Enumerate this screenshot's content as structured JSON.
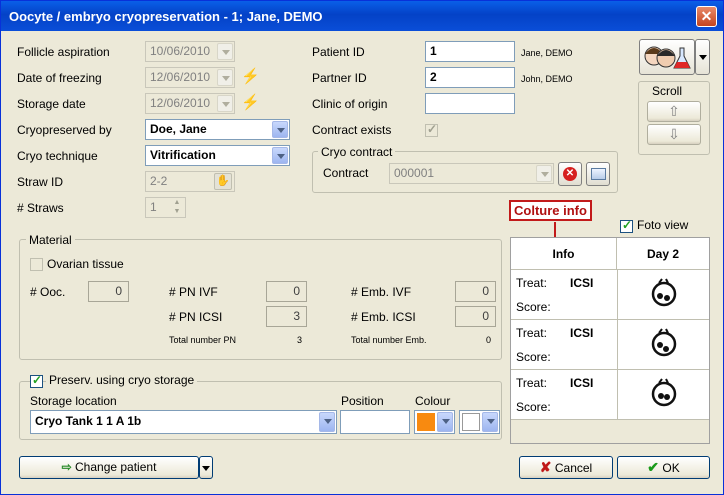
{
  "window": {
    "title": "Oocyte / embryo cryopreservation - 1; Jane, DEMO",
    "close_glyph": "✕"
  },
  "left": {
    "follicle_aspiration": {
      "label": "Follicle aspiration",
      "value": "10/06/2010"
    },
    "date_of_freezing": {
      "label": "Date of freezing",
      "value": "12/06/2010"
    },
    "storage_date": {
      "label": "Storage date",
      "value": "12/06/2010"
    },
    "cryopreserved_by": {
      "label": "Cryopreserved by",
      "value": "Doe, Jane"
    },
    "cryo_technique": {
      "label": "Cryo technique",
      "value": "Vitrification"
    },
    "straw_id": {
      "label": "Straw ID",
      "value": "2-2"
    },
    "straws": {
      "label": "# Straws",
      "value": "1"
    }
  },
  "middle": {
    "patient_id": {
      "label": "Patient ID",
      "value": "1",
      "name": "Jane, DEMO"
    },
    "partner_id": {
      "label": "Partner ID",
      "value": "2",
      "name": "John, DEMO"
    },
    "clinic_of_origin": {
      "label": "Clinic of origin",
      "value": ""
    },
    "contract_exists": {
      "label": "Contract exists"
    },
    "cryo_contract": {
      "legend": "Cryo contract",
      "label": "Contract",
      "value": "000001"
    }
  },
  "scroll": {
    "label": "Scroll",
    "up": "⇧",
    "down": "⇩"
  },
  "annotation": {
    "label": "Colture info"
  },
  "foto_view": {
    "label": "Foto view"
  },
  "culture_table": {
    "headers": [
      "Info",
      "Day 2"
    ],
    "rows": [
      {
        "treat_label": "Treat:",
        "treat": "ICSI",
        "score_label": "Score:"
      },
      {
        "treat_label": "Treat:",
        "treat": "ICSI",
        "score_label": "Score:"
      },
      {
        "treat_label": "Treat:",
        "treat": "ICSI",
        "score_label": "Score:"
      }
    ]
  },
  "material": {
    "legend": "Material",
    "ovarian_tissue": "Ovarian tissue",
    "ooc": {
      "label": "# Ooc.",
      "value": "0"
    },
    "pn_ivf": {
      "label": "# PN IVF",
      "value": "0"
    },
    "pn_icsi": {
      "label": "# PN ICSI",
      "value": "3"
    },
    "total_pn": {
      "label": "Total number PN",
      "value": "3"
    },
    "emb_ivf": {
      "label": "# Emb. IVF",
      "value": "0"
    },
    "emb_icsi": {
      "label": "# Emb. ICSI",
      "value": "0"
    },
    "total_emb": {
      "label": "Total number Emb.",
      "value": "0"
    }
  },
  "storage": {
    "preserve_label": "Preserv. using cryo storage",
    "location_label": "Storage location",
    "location_value": "Cryo Tank 1 1 A 1b",
    "position_label": "Position",
    "position_value": "",
    "colour_label": "Colour",
    "colour_primary": "#f88a10",
    "colour_secondary": "#ffffff"
  },
  "footer": {
    "change_patient": "Change patient",
    "cancel": "Cancel",
    "ok": "OK"
  }
}
